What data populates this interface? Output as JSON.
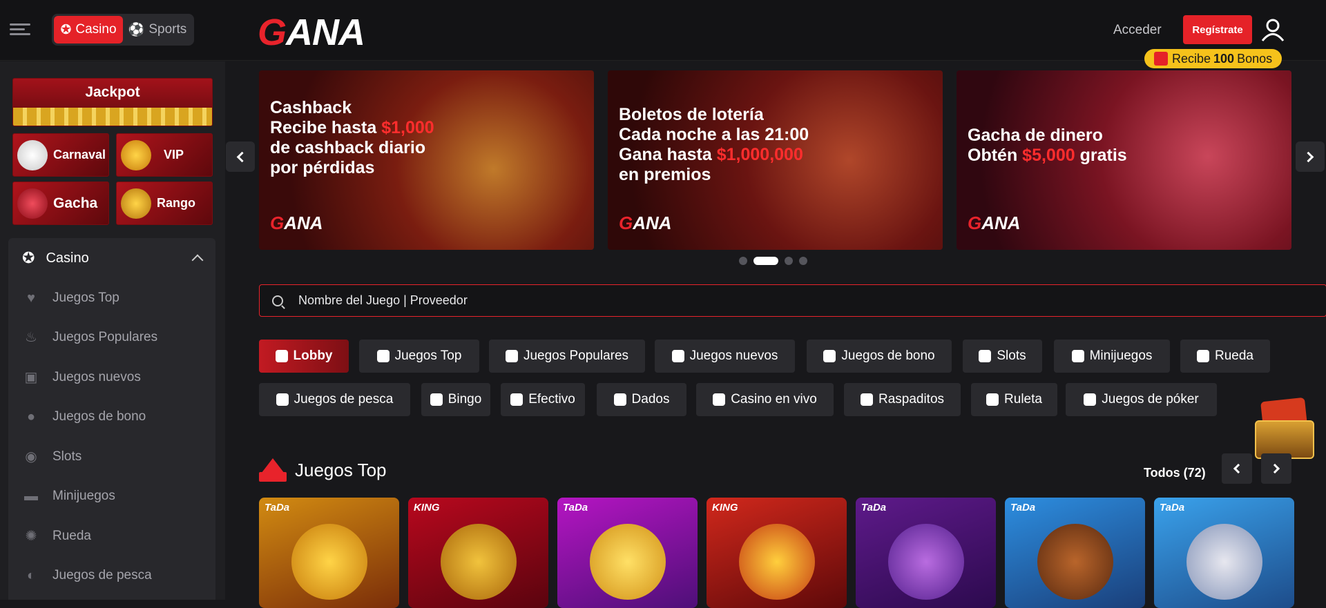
{
  "header": {
    "mode_switch": {
      "casino": "Casino",
      "sports": "Sports"
    },
    "logo": {
      "first": "G",
      "rest": "ANA"
    },
    "login_label": "Acceder",
    "register_label": "Regístrate",
    "bonus": {
      "pre": "Recibe",
      "amount": "100",
      "post": "Bonos"
    }
  },
  "sidebar": {
    "promos": {
      "jackpot": "Jackpot",
      "carnaval": "Carnaval",
      "vip": "VIP",
      "gacha": "Gacha",
      "rango": "Rango"
    },
    "section_title": "Casino",
    "items": [
      {
        "label": "Juegos Top",
        "icon": "heart-pulse-icon"
      },
      {
        "label": "Juegos Populares",
        "icon": "fire-icon"
      },
      {
        "label": "Juegos nuevos",
        "icon": "gift-icon"
      },
      {
        "label": "Juegos de bono",
        "icon": "bonus-coin-icon"
      },
      {
        "label": "Slots",
        "icon": "slot-icon"
      },
      {
        "label": "Minijuegos",
        "icon": "gamepad-icon"
      },
      {
        "label": "Rueda",
        "icon": "wheel-icon"
      },
      {
        "label": "Juegos de pesca",
        "icon": "fish-icon"
      }
    ]
  },
  "banners": [
    {
      "lines": [
        "Cashback",
        "Recibe hasta ",
        "$1,000",
        "de cashback diario",
        "por pérdidas"
      ]
    },
    {
      "lines": [
        "Boletos de lotería",
        "Cada noche a las 21:00",
        "Gana hasta ",
        "$1,000,000",
        "en premios"
      ]
    },
    {
      "lines": [
        "Gacha de dinero",
        "Obtén ",
        "$5,000",
        " gratis"
      ]
    }
  ],
  "search": {
    "placeholder": "Nombre del Juego | Proveedor"
  },
  "categories": [
    "Lobby",
    "Juegos Top",
    "Juegos Populares",
    "Juegos nuevos",
    "Juegos de bono",
    "Slots",
    "Minijuegos",
    "Rueda",
    "Juegos de pesca",
    "Bingo",
    "Efectivo",
    "Dados",
    "Casino en vivo",
    "Raspaditos",
    "Ruleta",
    "Juegos de póker"
  ],
  "top_games": {
    "title": "Juegos Top",
    "all_label": "Todos (72)",
    "providers": [
      "TaDa",
      "KING",
      "TaDa",
      "KING",
      "TaDa",
      "TaDa",
      "TaDa"
    ]
  },
  "colors": {
    "accent": "#e52228",
    "bonus_badge": "#f5c21b",
    "background": "#18181b"
  }
}
